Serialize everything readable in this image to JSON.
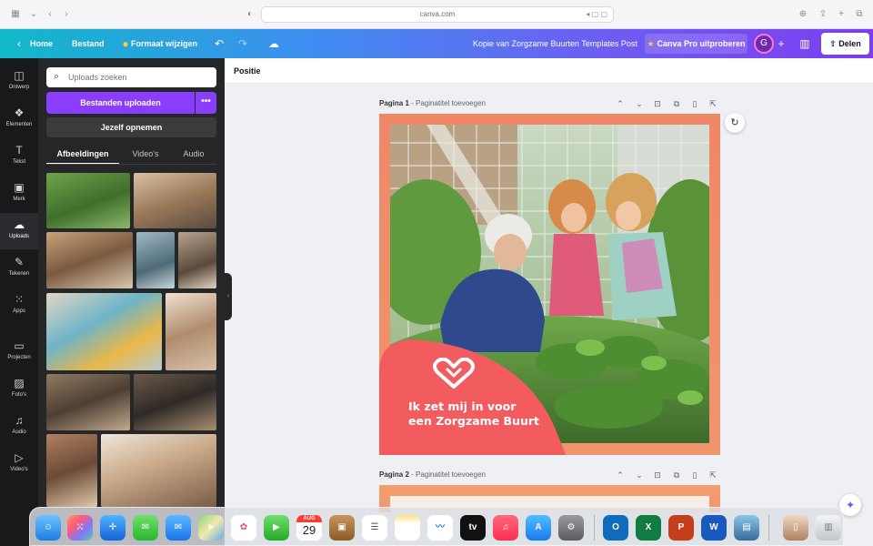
{
  "browser": {
    "url": "canva.com",
    "right_icons": "◂ ▢ ▢"
  },
  "header": {
    "home": "Home",
    "file": "Bestand",
    "resize": "Formaat wijzigen",
    "doc_title": "Kopie van Zorgzame Buurten Templates Post",
    "pro": "Canva Pro uitproberen",
    "avatar_initial": "G",
    "share": "Delen"
  },
  "rail": [
    {
      "label": "Ontwerp",
      "icon": "layout-icon",
      "glyph": "◫"
    },
    {
      "label": "Elementen",
      "icon": "elements-icon",
      "glyph": "❖"
    },
    {
      "label": "Tekst",
      "icon": "text-icon",
      "glyph": "T"
    },
    {
      "label": "Merk",
      "icon": "brand-icon",
      "glyph": "▣"
    },
    {
      "label": "Uploads",
      "icon": "cloud-upload-icon",
      "glyph": "☁"
    },
    {
      "label": "Tekenen",
      "icon": "draw-icon",
      "glyph": "✎"
    },
    {
      "label": "Apps",
      "icon": "apps-icon",
      "glyph": "⁙"
    },
    {
      "label": "Projecten",
      "icon": "folder-icon",
      "glyph": "▭"
    },
    {
      "label": "Foto's",
      "icon": "photos-icon",
      "glyph": "▨"
    },
    {
      "label": "Audio",
      "icon": "music-icon",
      "glyph": "♫"
    },
    {
      "label": "Video's",
      "icon": "video-icon",
      "glyph": "▷"
    }
  ],
  "panel": {
    "search_placeholder": "Uploads zoeken",
    "upload_button": "Bestanden uploaden",
    "more": "•••",
    "record_button": "Jezelf opnemen",
    "tabs": [
      "Afbeeldingen",
      "Video's",
      "Audio"
    ]
  },
  "toolbar": {
    "position": "Positie"
  },
  "pages": [
    {
      "label": "Pagina 1",
      "add_title": "Paginatitel toevoegen"
    },
    {
      "label": "Pagina 2",
      "add_title": "Paginatitel toevoegen"
    }
  ],
  "design": {
    "headline_line1": "Ik zet mij in voor",
    "headline_line2": "een Zorgzame Buurt"
  },
  "dock": {
    "calendar_month": "AUG",
    "calendar_day": "29",
    "apps": [
      "Finder",
      "Launchpad",
      "Safari",
      "Berichten",
      "Mail",
      "Kaarten",
      "Foto's",
      "FaceTime",
      "Agenda",
      "Notities",
      "Herinneringen",
      "Notities-geel",
      "Freeform",
      "TV",
      "Muziek",
      "App Store",
      "Systeeminstellingen",
      "Outlook",
      "Excel",
      "PowerPoint",
      "Word",
      "Voorvertoning",
      "Bestand",
      "Prullenmand"
    ]
  },
  "colors": {
    "canva_purple": "#8b3dff",
    "panel_bg": "#252627",
    "rail_bg": "#18191b",
    "design_orange": "#f08767",
    "blob_coral": "#f25c5f"
  }
}
